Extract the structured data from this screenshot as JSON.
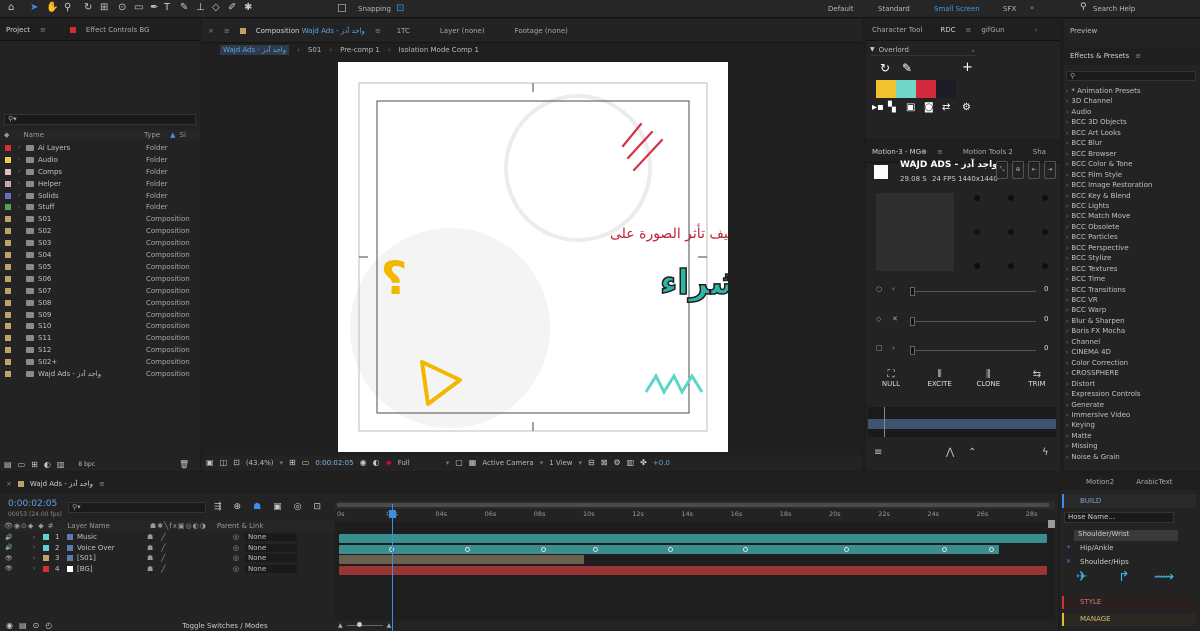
{
  "workspaces": [
    "Default",
    "Standard",
    "Small Screen",
    "SFX"
  ],
  "active_workspace": "Small Screen",
  "snapping_label": "Snapping",
  "search_help": "Search Help",
  "project_panel": {
    "tab": "Project",
    "effect_controls_tab": "Effect Controls BG",
    "col_name": "Name",
    "col_type": "Type",
    "col_size": "Si",
    "bpc": "8 bpc",
    "items": [
      {
        "name": "Ai Layers",
        "type": "Folder",
        "color": "#d42f2f"
      },
      {
        "name": "Audio",
        "type": "Folder",
        "color": "#e6d24a"
      },
      {
        "name": "Comps",
        "type": "Folder",
        "color": "#e7b9c9"
      },
      {
        "name": "Helper",
        "type": "Folder",
        "color": "#c9a8a8"
      },
      {
        "name": "Solids",
        "type": "Folder",
        "color": "#6a6cc4"
      },
      {
        "name": "Stuff",
        "type": "Folder",
        "color": "#53a353"
      },
      {
        "name": "S01",
        "type": "Composition",
        "color": "#c0a16e"
      },
      {
        "name": "S02",
        "type": "Composition",
        "color": "#c0a16e"
      },
      {
        "name": "S03",
        "type": "Composition",
        "color": "#c0a16e"
      },
      {
        "name": "S04",
        "type": "Composition",
        "color": "#c0a16e"
      },
      {
        "name": "S05",
        "type": "Composition",
        "color": "#c0a16e"
      },
      {
        "name": "S06",
        "type": "Composition",
        "color": "#c0a16e"
      },
      {
        "name": "S07",
        "type": "Composition",
        "color": "#c0a16e"
      },
      {
        "name": "S08",
        "type": "Composition",
        "color": "#c0a16e"
      },
      {
        "name": "S09",
        "type": "Composition",
        "color": "#c0a16e"
      },
      {
        "name": "S10",
        "type": "Composition",
        "color": "#c0a16e"
      },
      {
        "name": "S11",
        "type": "Composition",
        "color": "#c0a16e"
      },
      {
        "name": "S12",
        "type": "Composition",
        "color": "#c0a16e"
      },
      {
        "name": "S02+",
        "type": "Composition",
        "color": "#c0a16e"
      },
      {
        "name": "Wajd Ads - واجد آدز",
        "type": "Composition",
        "color": "#c0a16e"
      }
    ]
  },
  "comp_panel": {
    "tab_prefix": "Composition",
    "tab_name": "Wajd Ads - واجد آدز",
    "tab_1tc": "1TC",
    "layer_tab": "Layer (none)",
    "footage_tab": "Footage (none)",
    "breadcrumbs": [
      "Wajd Ads - واجد آدز",
      "S01",
      "Pre-comp 1",
      "Isolation Mode Comp 1"
    ],
    "zoom": "(43.4%)",
    "timecode": "0:00:02:05",
    "resolution": "Full",
    "camera": "Active Camera",
    "view": "1 View",
    "exposure": "+0.0",
    "artwork": {
      "line1": "كيف تأثر الصورة على",
      "line2": "عملية الشراء",
      "qmark": "؟"
    }
  },
  "character_panel": {
    "tabs": [
      "Character Tool",
      "RDC",
      "gifGun"
    ],
    "preset": "Overlord",
    "swatches": [
      "#f2c12e",
      "#6fd6c8",
      "#d42a3e",
      "#1c1c24"
    ]
  },
  "motion_panel": {
    "tabs": [
      "Motion-3 - MG⊕",
      "Motion Tools 2",
      "Sha"
    ],
    "comp_name": "WAJD ADS - واجد آدز",
    "duration": "29.08 S",
    "fps": "24 FPS",
    "size": "1440x1440",
    "sliders": [
      {
        "value": "0"
      },
      {
        "value": "0"
      },
      {
        "value": "0"
      }
    ],
    "actions": [
      "NULL",
      "EXCITE",
      "CLONE",
      "TRIM"
    ]
  },
  "preview_tab": "Preview",
  "effects_panel": {
    "tab": "Effects & Presets",
    "items": [
      "* Animation Presets",
      "3D Channel",
      "Audio",
      "BCC 3D Objects",
      "BCC Art Looks",
      "BCC Blur",
      "BCC Browser",
      "BCC Color & Tone",
      "BCC Film Style",
      "BCC Image Restoration",
      "BCC Key & Blend",
      "BCC Lights",
      "BCC Match Move",
      "BCC Obsolete",
      "BCC Particles",
      "BCC Perspective",
      "BCC Stylize",
      "BCC Textures",
      "BCC Time",
      "BCC Transitions",
      "BCC VR",
      "BCC Warp",
      "Blur & Sharpen",
      "Boris FX Mocha",
      "Channel",
      "CINEMA 4D",
      "Color Correction",
      "CROSSPHERE",
      "Distort",
      "Expression Controls",
      "Generate",
      "Immersive Video",
      "Keying",
      "Matte",
      "Missing",
      "Noise & Grain"
    ]
  },
  "timeline": {
    "tab": "Wajd Ads - واجد آدز",
    "timecode": "0:00:02:05",
    "frames": "00053 (24.00 fps)",
    "col_layer": "Layer Name",
    "col_parent": "Parent & Link",
    "toggle": "Toggle Switches / Modes",
    "ticks": [
      "0s",
      "02s",
      "04s",
      "06s",
      "08s",
      "10s",
      "12s",
      "14s",
      "16s",
      "18s",
      "20s",
      "22s",
      "24s",
      "26s",
      "28s"
    ],
    "layers": [
      {
        "num": "1",
        "name": "Music",
        "parent": "None",
        "label": "#5fd0d3"
      },
      {
        "num": "2",
        "name": "Voice Over",
        "parent": "None",
        "label": "#5fd0d3"
      },
      {
        "num": "3",
        "name": "[S01]",
        "parent": "None",
        "label": "#c0a16e"
      },
      {
        "num": "4",
        "name": "[BG]",
        "parent": "None",
        "label": "#d42f2f"
      }
    ]
  },
  "motion2_panel": {
    "tabs": [
      "Motion2",
      "ArabicText"
    ],
    "build": "BUILD",
    "hose": "Hose Name...",
    "options": [
      "Shoulder/Wrist",
      "Hip/Ankle",
      "Shoulder/Hips"
    ],
    "style": "STYLE",
    "manage": "MANAGE"
  }
}
